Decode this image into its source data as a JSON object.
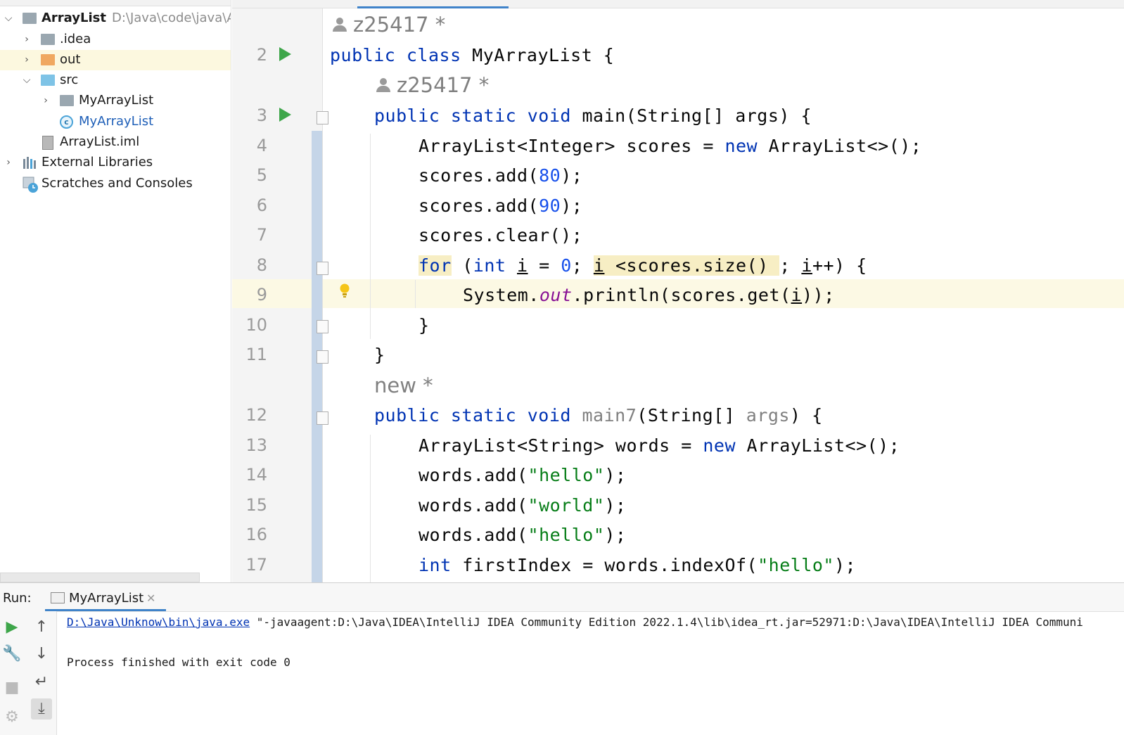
{
  "project": {
    "root_name": "ArrayList",
    "root_path": "D:\\Java\\code\\java\\Arr",
    "items": [
      {
        "label": ".idea"
      },
      {
        "label": "out"
      },
      {
        "label": "src"
      },
      {
        "label": "MyArrayList"
      },
      {
        "label": "MyArrayList"
      },
      {
        "label": "ArrayList.iml"
      },
      {
        "label": "External Libraries"
      },
      {
        "label": "Scratches and Consoles"
      }
    ]
  },
  "editor": {
    "author1": "z25417 *",
    "author2": "z25417 *",
    "author3": "new *",
    "line_numbers": [
      "2",
      "3",
      "4",
      "5",
      "6",
      "7",
      "8",
      "9",
      "10",
      "11",
      "12",
      "13",
      "14",
      "15",
      "16",
      "17"
    ]
  },
  "run": {
    "label": "Run:",
    "tab": "MyArrayList",
    "console_path": "D:\\Java\\Unknow\\bin\\java.exe",
    "console_args": " \"-javaagent:D:\\Java\\IDEA\\IntelliJ IDEA Community Edition 2022.1.4\\lib\\idea_rt.jar=52971:D:\\Java\\IDEA\\IntelliJ IDEA Communi",
    "console_exit": "Process finished with exit code 0"
  }
}
